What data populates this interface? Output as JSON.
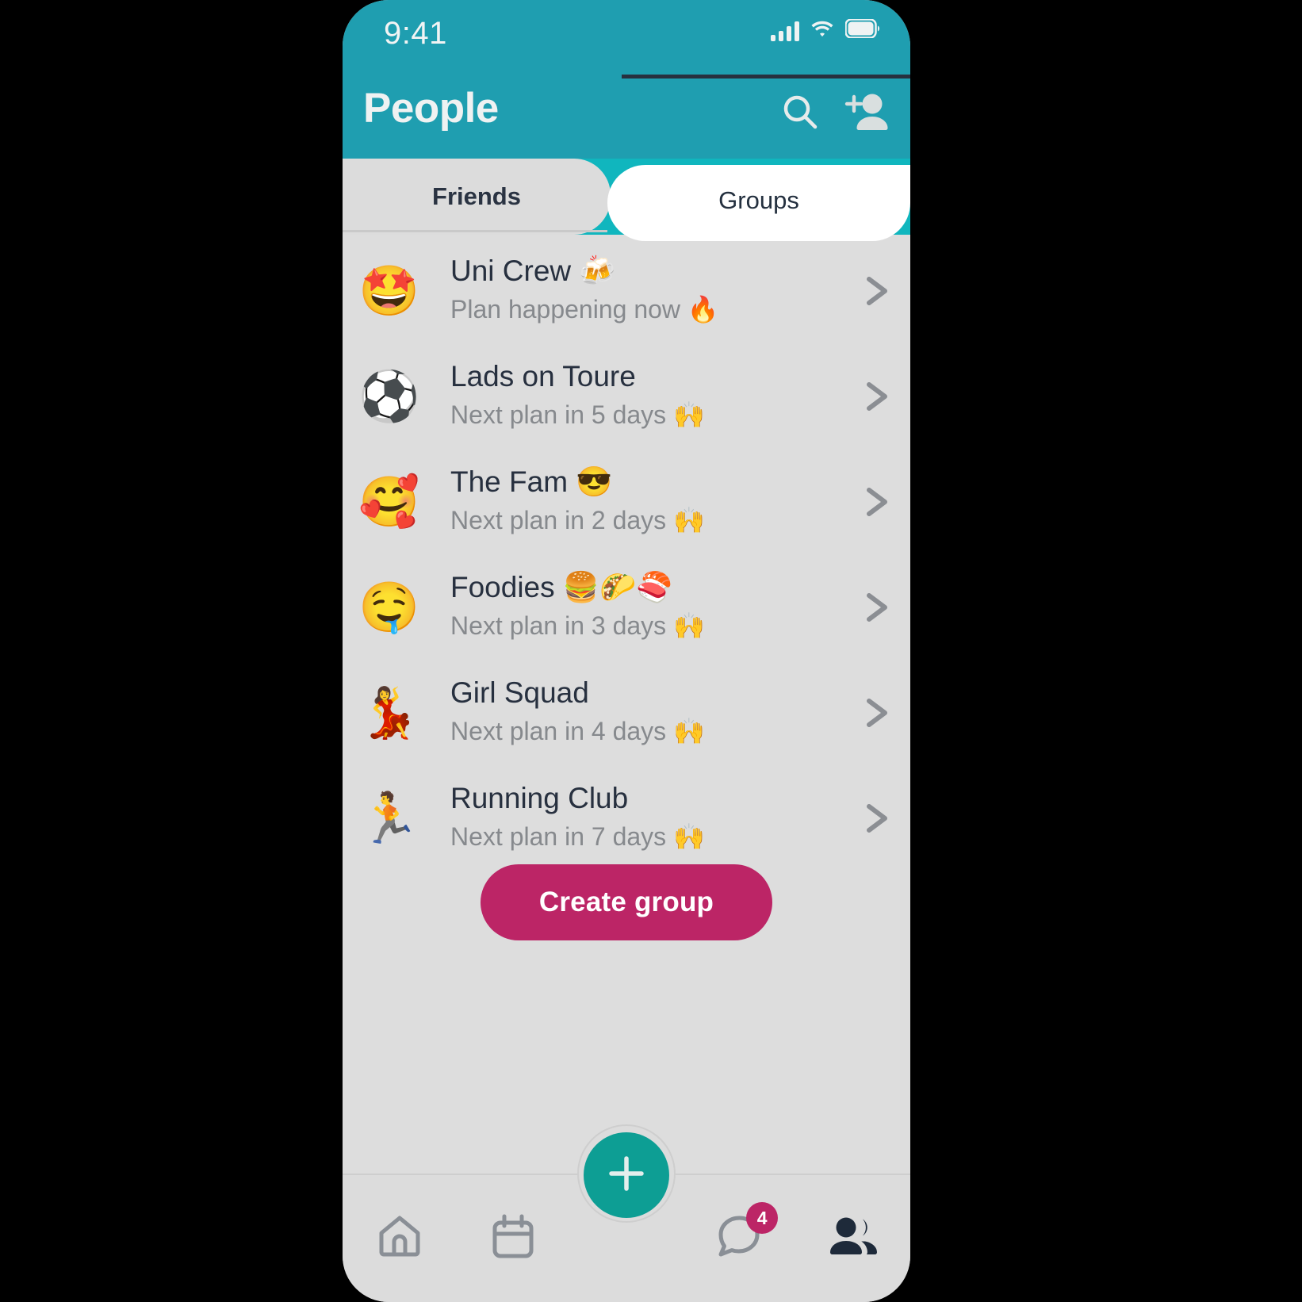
{
  "status_bar": {
    "time": "9:41",
    "signal_icon": "cellular-signal-icon",
    "wifi_icon": "wifi-icon",
    "battery_icon": "battery-icon"
  },
  "header": {
    "title": "People",
    "search_icon": "search-icon",
    "add_person_icon": "add-person-icon",
    "background_color": "#1F9EB0"
  },
  "tabs": {
    "strip_color": "#10B6BE",
    "active": "Groups",
    "items": [
      {
        "label": "Friends",
        "active": false
      },
      {
        "label": "Groups",
        "active": true
      }
    ]
  },
  "groups": [
    {
      "emoji": "🤩",
      "title": "Uni Crew 🍻",
      "subtitle": "Plan happening now 🔥",
      "chevron_icon": "chevron-right-icon"
    },
    {
      "emoji": "⚽",
      "title": "Lads on Toure",
      "subtitle": "Next plan in 5 days 🙌",
      "chevron_icon": "chevron-right-icon"
    },
    {
      "emoji": "🥰",
      "title": "The Fam 😎",
      "subtitle": "Next plan in 2 days 🙌",
      "chevron_icon": "chevron-right-icon"
    },
    {
      "emoji": "🤤",
      "title": "Foodies 🍔🌮🍣",
      "subtitle": "Next plan in 3 days 🙌",
      "chevron_icon": "chevron-right-icon"
    },
    {
      "emoji": "💃",
      "title": "Girl Squad",
      "subtitle": "Next plan in 4 days 🙌",
      "chevron_icon": "chevron-right-icon"
    },
    {
      "emoji": "🏃",
      "title": "Running Club",
      "subtitle": "Next plan in 7 days 🙌",
      "chevron_icon": "chevron-right-icon"
    }
  ],
  "create_group": {
    "label": "Create group",
    "color": "#BC2566"
  },
  "bottom_nav": {
    "items": [
      {
        "name": "home",
        "icon": "home-icon",
        "active": false
      },
      {
        "name": "calendar",
        "icon": "calendar-icon",
        "active": false
      },
      {
        "name": "create",
        "icon": "plus-icon",
        "active": false
      },
      {
        "name": "chat",
        "icon": "chat-bubble-icon",
        "active": false,
        "badge": "4"
      },
      {
        "name": "people",
        "icon": "people-icon",
        "active": true
      }
    ],
    "fab_color": "#0D9E94",
    "badge_color": "#BC2566",
    "active_color": "#1E2A3A",
    "inactive_color": "#8A8F96"
  }
}
